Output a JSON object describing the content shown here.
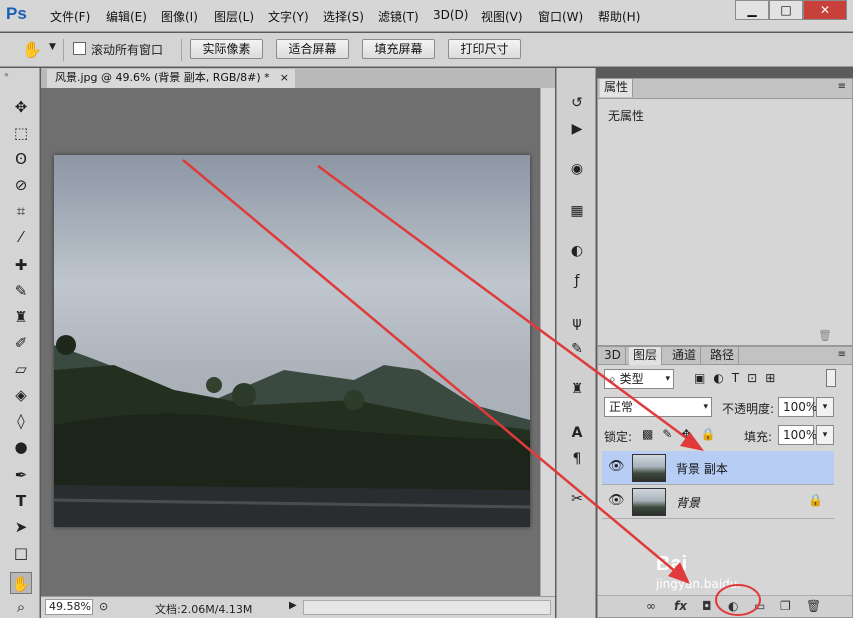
{
  "app": {
    "logo": "Ps"
  },
  "menu": [
    "文件(F)",
    "编辑(E)",
    "图像(I)",
    "图层(L)",
    "文字(Y)",
    "选择(S)",
    "滤镜(T)",
    "3D(D)",
    "视图(V)",
    "窗口(W)",
    "帮助(H)"
  ],
  "window_controls": {
    "minimize": "▁",
    "maximize": "□",
    "close": "✕"
  },
  "options": {
    "scroll_all_label": "滚动所有窗口",
    "actual_pixels": "实际像素",
    "fit_screen": "适合屏幕",
    "fill_screen": "填充屏幕",
    "print_size": "打印尺寸"
  },
  "document": {
    "tab_title": "风景.jpg @ 49.6% (背景 副本, RGB/8#) *",
    "tab_close": "×",
    "zoom": "49.58%",
    "doc_size": "文档:2.06M/4.13M"
  },
  "properties": {
    "title": "属性",
    "content": "无属性"
  },
  "layers_panel": {
    "tabs": [
      "3D",
      "图层",
      "通道",
      "路径"
    ],
    "filter_label": "类型",
    "blend_mode": "正常",
    "opacity_label": "不透明度:",
    "opacity": "100%",
    "lock_label": "锁定:",
    "fill_label": "填充:",
    "fill": "100%",
    "layers": [
      {
        "name": "背景 副本",
        "selected": true
      },
      {
        "name": "背景",
        "selected": false,
        "locked": true
      }
    ]
  },
  "watermark": {
    "text": "jingyan.baidu.",
    "logo": "Bai"
  },
  "colors": {
    "selection": "#b7cdf3",
    "annotation": "#e03a3a",
    "ps_blue": "#1a5fb4"
  }
}
